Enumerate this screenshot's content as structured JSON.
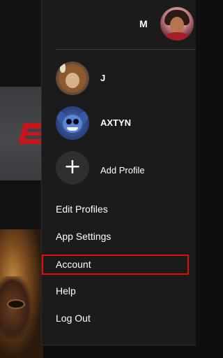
{
  "header": {
    "current_profile_initial": "M",
    "current_profile_avatar_icon": "woman-avatar-icon"
  },
  "profiles": [
    {
      "name": "J",
      "avatar_icon": "beast-avatar-icon"
    },
    {
      "name": "AXTYN",
      "avatar_icon": "stitch-avatar-icon"
    }
  ],
  "add_profile": {
    "label": "Add Profile",
    "icon": "plus-icon"
  },
  "menu_items": [
    {
      "label": "Edit Profiles"
    },
    {
      "label": "App Settings"
    },
    {
      "label": "Account",
      "highlighted": true
    },
    {
      "label": "Help"
    },
    {
      "label": "Log Out"
    }
  ],
  "colors": {
    "panel_bg": "#1b1b1b",
    "highlight_border": "#e60c0c",
    "text": "#ffffff"
  }
}
